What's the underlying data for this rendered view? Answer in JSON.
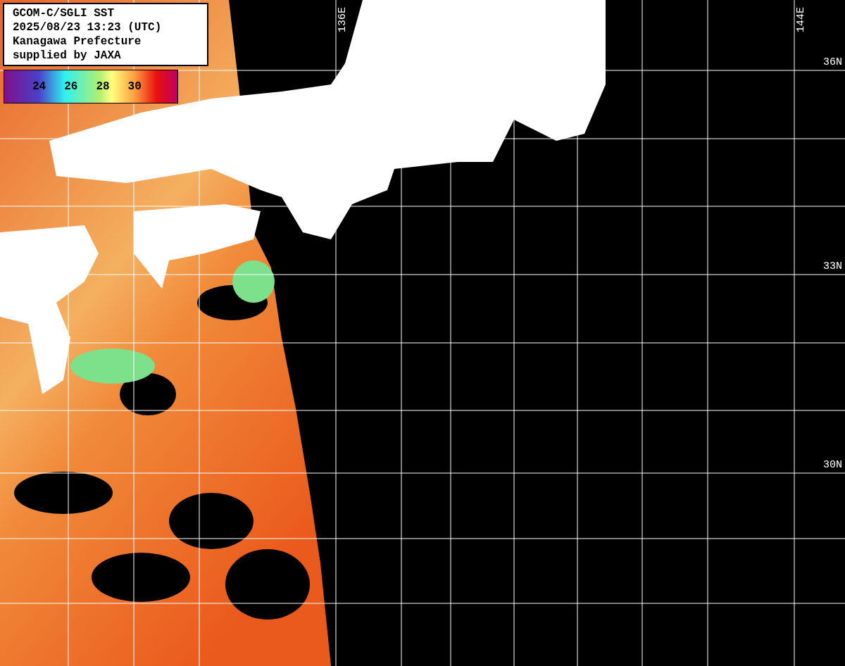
{
  "info_box": {
    "lines": [
      "GCOM-C/SGLI SST",
      "2025/08/23 13:23 (UTC)",
      "Kanagawa Prefecture",
      "supplied by JAXA"
    ]
  },
  "color_scale": {
    "labels": [
      "24",
      "26",
      "28",
      "30"
    ]
  },
  "longitude_labels": [
    "136E",
    "144E"
  ],
  "latitude_labels": [
    "36N",
    "33N",
    "30N"
  ]
}
